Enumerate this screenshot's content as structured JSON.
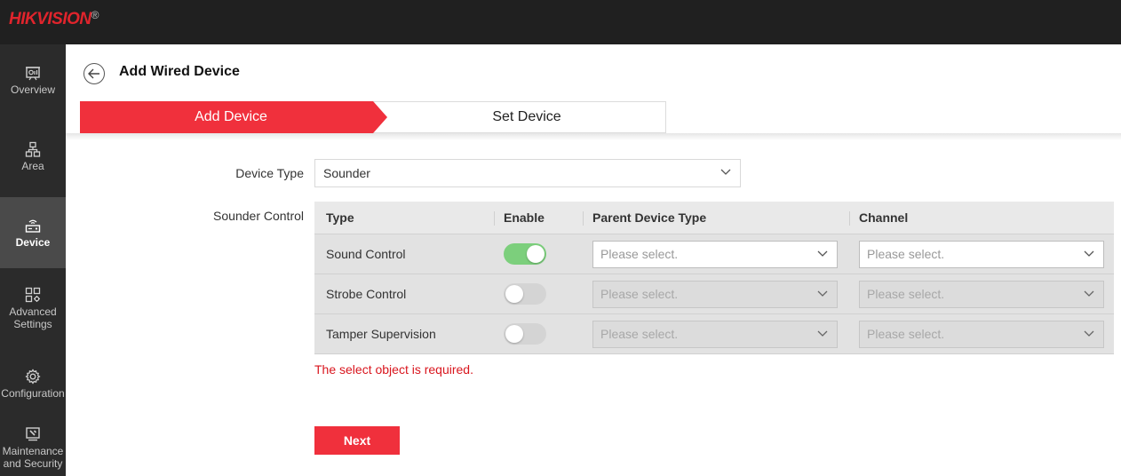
{
  "brand": {
    "name_part1": "HIK",
    "name_part2": "VISION",
    "reg": "®"
  },
  "sidebar": {
    "items": [
      {
        "label": "Overview",
        "icon": "overview-icon"
      },
      {
        "label": "Area",
        "icon": "area-icon"
      },
      {
        "label": "Device",
        "icon": "device-icon",
        "active": true
      },
      {
        "label_line1": "Advanced",
        "label_line2": "Settings",
        "icon": "advanced-settings-icon"
      },
      {
        "label": "Configuration",
        "icon": "gear-icon"
      },
      {
        "label_line1": "Maintenance",
        "label_line2": "and Security",
        "icon": "maintenance-icon"
      }
    ]
  },
  "header": {
    "title": "Add Wired Device"
  },
  "steps": {
    "step1": "Add Device",
    "step2": "Set Device",
    "active_color": "#f0303c"
  },
  "form": {
    "device_type_label": "Device Type",
    "device_type_value": "Sounder",
    "sounder_control_label": "Sounder Control"
  },
  "table": {
    "headers": {
      "type": "Type",
      "enable": "Enable",
      "parent": "Parent Device Type",
      "channel": "Channel"
    },
    "rows": [
      {
        "type": "Sound Control",
        "enabled": true,
        "parent_placeholder": "Please select.",
        "channel_placeholder": "Please select."
      },
      {
        "type": "Strobe Control",
        "enabled": false,
        "parent_placeholder": "Please select.",
        "channel_placeholder": "Please select."
      },
      {
        "type": "Tamper Supervision",
        "enabled": false,
        "parent_placeholder": "Please select.",
        "channel_placeholder": "Please select."
      }
    ]
  },
  "error_message": "The select object is required.",
  "next_button": "Next",
  "colors": {
    "accent": "#f0303c",
    "toggle_on": "#7ccf7c",
    "sidebar_bg": "#2b2b2b",
    "topbar_bg": "#202020"
  }
}
